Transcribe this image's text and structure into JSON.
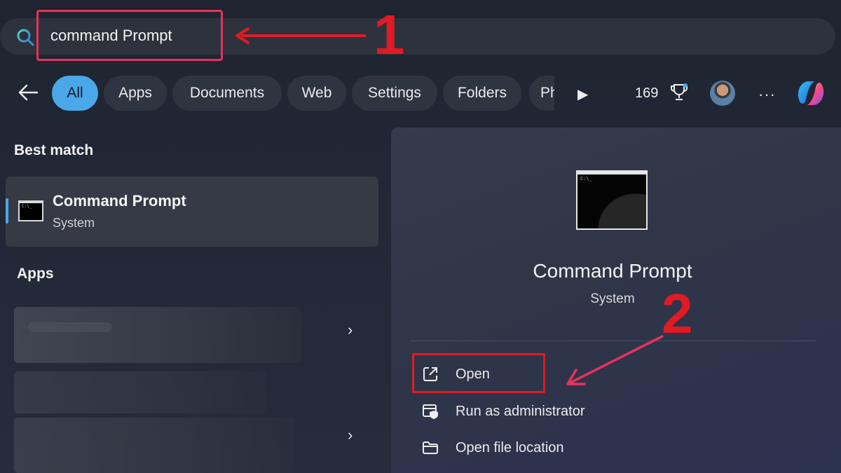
{
  "search": {
    "query": "command Prompt"
  },
  "filters": {
    "items": [
      {
        "label": "All",
        "active": true
      },
      {
        "label": "Apps"
      },
      {
        "label": "Documents"
      },
      {
        "label": "Web"
      },
      {
        "label": "Settings"
      },
      {
        "label": "Folders"
      }
    ],
    "overflow_label": "Ph",
    "count": "169"
  },
  "icons": {
    "search": "search-icon",
    "back": "back-arrow-icon",
    "play": "play-icon",
    "trophy": "rewards-trophy-icon",
    "more": "more-icon",
    "copilot": "copilot-icon",
    "open": "open-external-icon",
    "admin": "shield-admin-icon",
    "folder": "folder-icon",
    "chevron": "chevron-right-icon"
  },
  "best_match": {
    "heading": "Best match",
    "name": "Command Prompt",
    "subtitle": "System",
    "prompt_text": "C:\\_"
  },
  "apps": {
    "heading": "Apps"
  },
  "detail": {
    "name": "Command Prompt",
    "subtitle": "System",
    "prompt_text": "C:\\_",
    "actions": [
      {
        "label": "Open"
      },
      {
        "label": "Run as administrator"
      },
      {
        "label": "Open file location"
      }
    ]
  },
  "annotations": {
    "step1": "1",
    "step2": "2"
  },
  "colors": {
    "accent": "#4aa8e8",
    "annotation": "#e01b24",
    "annotation_pink": "#e8325c"
  },
  "more_glyph": "···",
  "play_glyph": "▶",
  "chevron_glyph": "›"
}
